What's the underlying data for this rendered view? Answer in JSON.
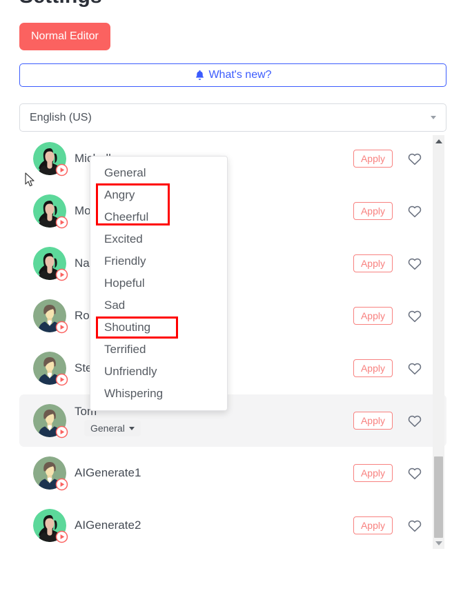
{
  "page": {
    "title": "Settings"
  },
  "toolbar": {
    "normal_editor_label": "Normal Editor",
    "whats_new_label": "What's new?",
    "whats_new_icon": "bell-icon",
    "accent_red": "#fb6260",
    "accent_blue": "#3b5bfd"
  },
  "language_select": {
    "value": "English (US)",
    "caret_icon": "chevron-down-icon"
  },
  "voice_list": {
    "apply_label": "Apply",
    "favorite_icon": "heart-outline-icon",
    "play_icon": "play-circle-icon",
    "rows": [
      {
        "name": "Michelle",
        "gender": "female",
        "visible_name": "Michelle",
        "occluded": false,
        "active": false
      },
      {
        "name": "Mo",
        "gender": "female",
        "visible_name": "Mo",
        "occluded": true,
        "active": false
      },
      {
        "name": "Na",
        "gender": "female",
        "visible_name": "Na",
        "occluded": true,
        "active": false
      },
      {
        "name": "Ro",
        "gender": "male",
        "visible_name": "Ro",
        "occluded": true,
        "active": false
      },
      {
        "name": "Ste",
        "gender": "male",
        "visible_name": "Ste",
        "occluded": true,
        "active": false
      },
      {
        "name": "Tom",
        "gender": "male",
        "visible_name": "Tom",
        "occluded": true,
        "active": true,
        "emotion": "General"
      },
      {
        "name": "AIGenerate1",
        "gender": "male",
        "visible_name": "AIGenerate1",
        "occluded": false,
        "active": false
      },
      {
        "name": "AIGenerate2",
        "gender": "female",
        "visible_name": "AIGenerate2",
        "occluded": false,
        "active": false
      }
    ]
  },
  "emotion_menu": {
    "open": true,
    "selected": "General",
    "items": [
      "General",
      "Angry",
      "Cheerful",
      "Excited",
      "Friendly",
      "Hopeful",
      "Sad",
      "Shouting",
      "Terrified",
      "Unfriendly",
      "Whispering"
    ]
  },
  "annotations": {
    "color": "#ff0000",
    "boxes": [
      {
        "id": "annot-angry-cheerful",
        "targets": [
          "Angry",
          "Cheerful"
        ]
      },
      {
        "id": "annot-shouting",
        "targets": [
          "Shouting"
        ]
      }
    ]
  },
  "scrollbar": {
    "up_icon": "arrow-up-icon",
    "down_icon": "arrow-down-icon",
    "thumb_position": "near-bottom"
  }
}
